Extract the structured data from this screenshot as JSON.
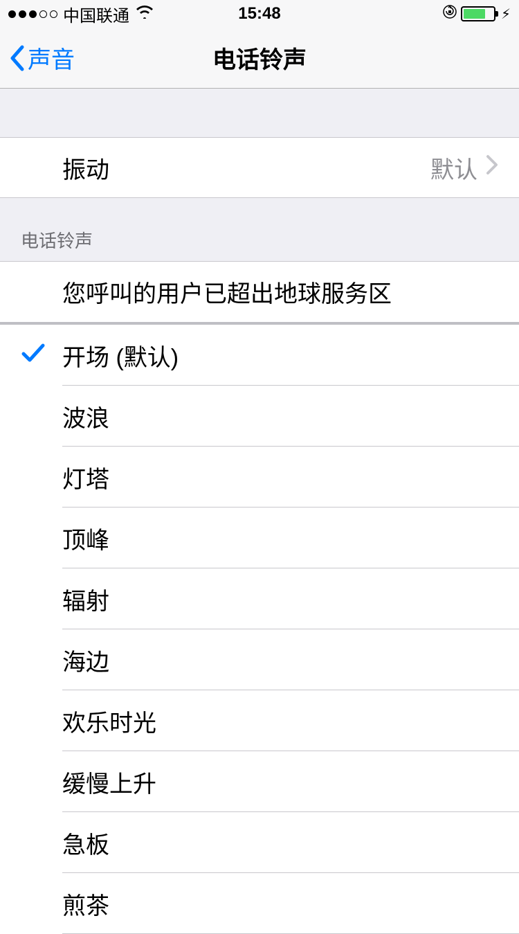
{
  "status": {
    "carrier": "中国联通",
    "time": "15:48"
  },
  "nav": {
    "back": "声音",
    "title": "电话铃声"
  },
  "vibration": {
    "label": "振动",
    "value": "默认"
  },
  "section_header": "电话铃声",
  "custom_ringtone": "您呼叫的用户已超出地球服务区",
  "ringtones": [
    {
      "label": "开场 (默认)",
      "selected": true
    },
    {
      "label": "波浪",
      "selected": false
    },
    {
      "label": "灯塔",
      "selected": false
    },
    {
      "label": "顶峰",
      "selected": false
    },
    {
      "label": "辐射",
      "selected": false
    },
    {
      "label": "海边",
      "selected": false
    },
    {
      "label": "欢乐时光",
      "selected": false
    },
    {
      "label": "缓慢上升",
      "selected": false
    },
    {
      "label": "急板",
      "selected": false
    },
    {
      "label": "煎茶",
      "selected": false
    }
  ]
}
